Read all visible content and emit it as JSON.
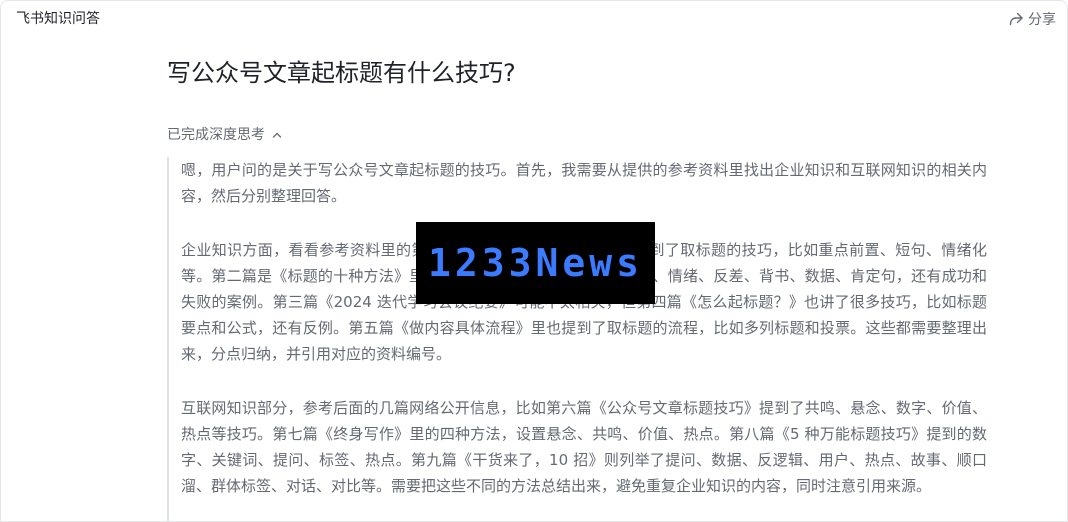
{
  "app": {
    "title": "飞书知识问答",
    "share_label": "分享"
  },
  "question": {
    "title": "写公众号文章起标题有什么技巧?"
  },
  "thinking": {
    "toggle_label": "已完成深度思考",
    "paragraphs": [
      "嗯，用户问的是关于写公众号文章起标题的技巧。首先，我需要从提供的参考资料里找出企业知识和互联网知识的相关内容，然后分别整理回答。",
      "企业知识方面，看看参考资料里的第一篇《公众号运营手册》，里面提到了取标题的技巧，比如重点前置、短句、情绪化等。第二篇是《标题的十种方法》里的多种方法，比如重点前置、短句、情绪、反差、背书、数据、肯定句，还有成功和失败的案例。第三篇《2024 迭代学习会议纪要》可能不太相关，但第四篇《怎么起标题？》也讲了很多技巧，比如标题要点和公式，还有反例。第五篇《做内容具体流程》里也提到了取标题的流程，比如多列标题和投票。这些都需要整理出来，分点归纳，并引用对应的资料编号。",
      "互联网知识部分，参考后面的几篇网络公开信息，比如第六篇《公众号文章标题技巧》提到了共鸣、悬念、数字、价值、热点等技巧。第七篇《终身写作》里的四种方法，设置悬念、共鸣、价值、热点。第八篇《5 种万能标题技巧》提到的数字、关键词、提问、标签、热点。第九篇《干货来了，10 招》则列举了提问、数据、反逻辑、用户、热点、故事、顺口溜、群体标签、对话、对比等。需要把这些不同的方法总结出来，避免重复企业知识的内容，同时注意引用来源。"
    ]
  },
  "watermark": {
    "text": "1233News",
    "color": "#3a7bff",
    "background": "#000000"
  },
  "icons": {
    "share": "share-icon",
    "collapse": "chevron-up-icon"
  }
}
